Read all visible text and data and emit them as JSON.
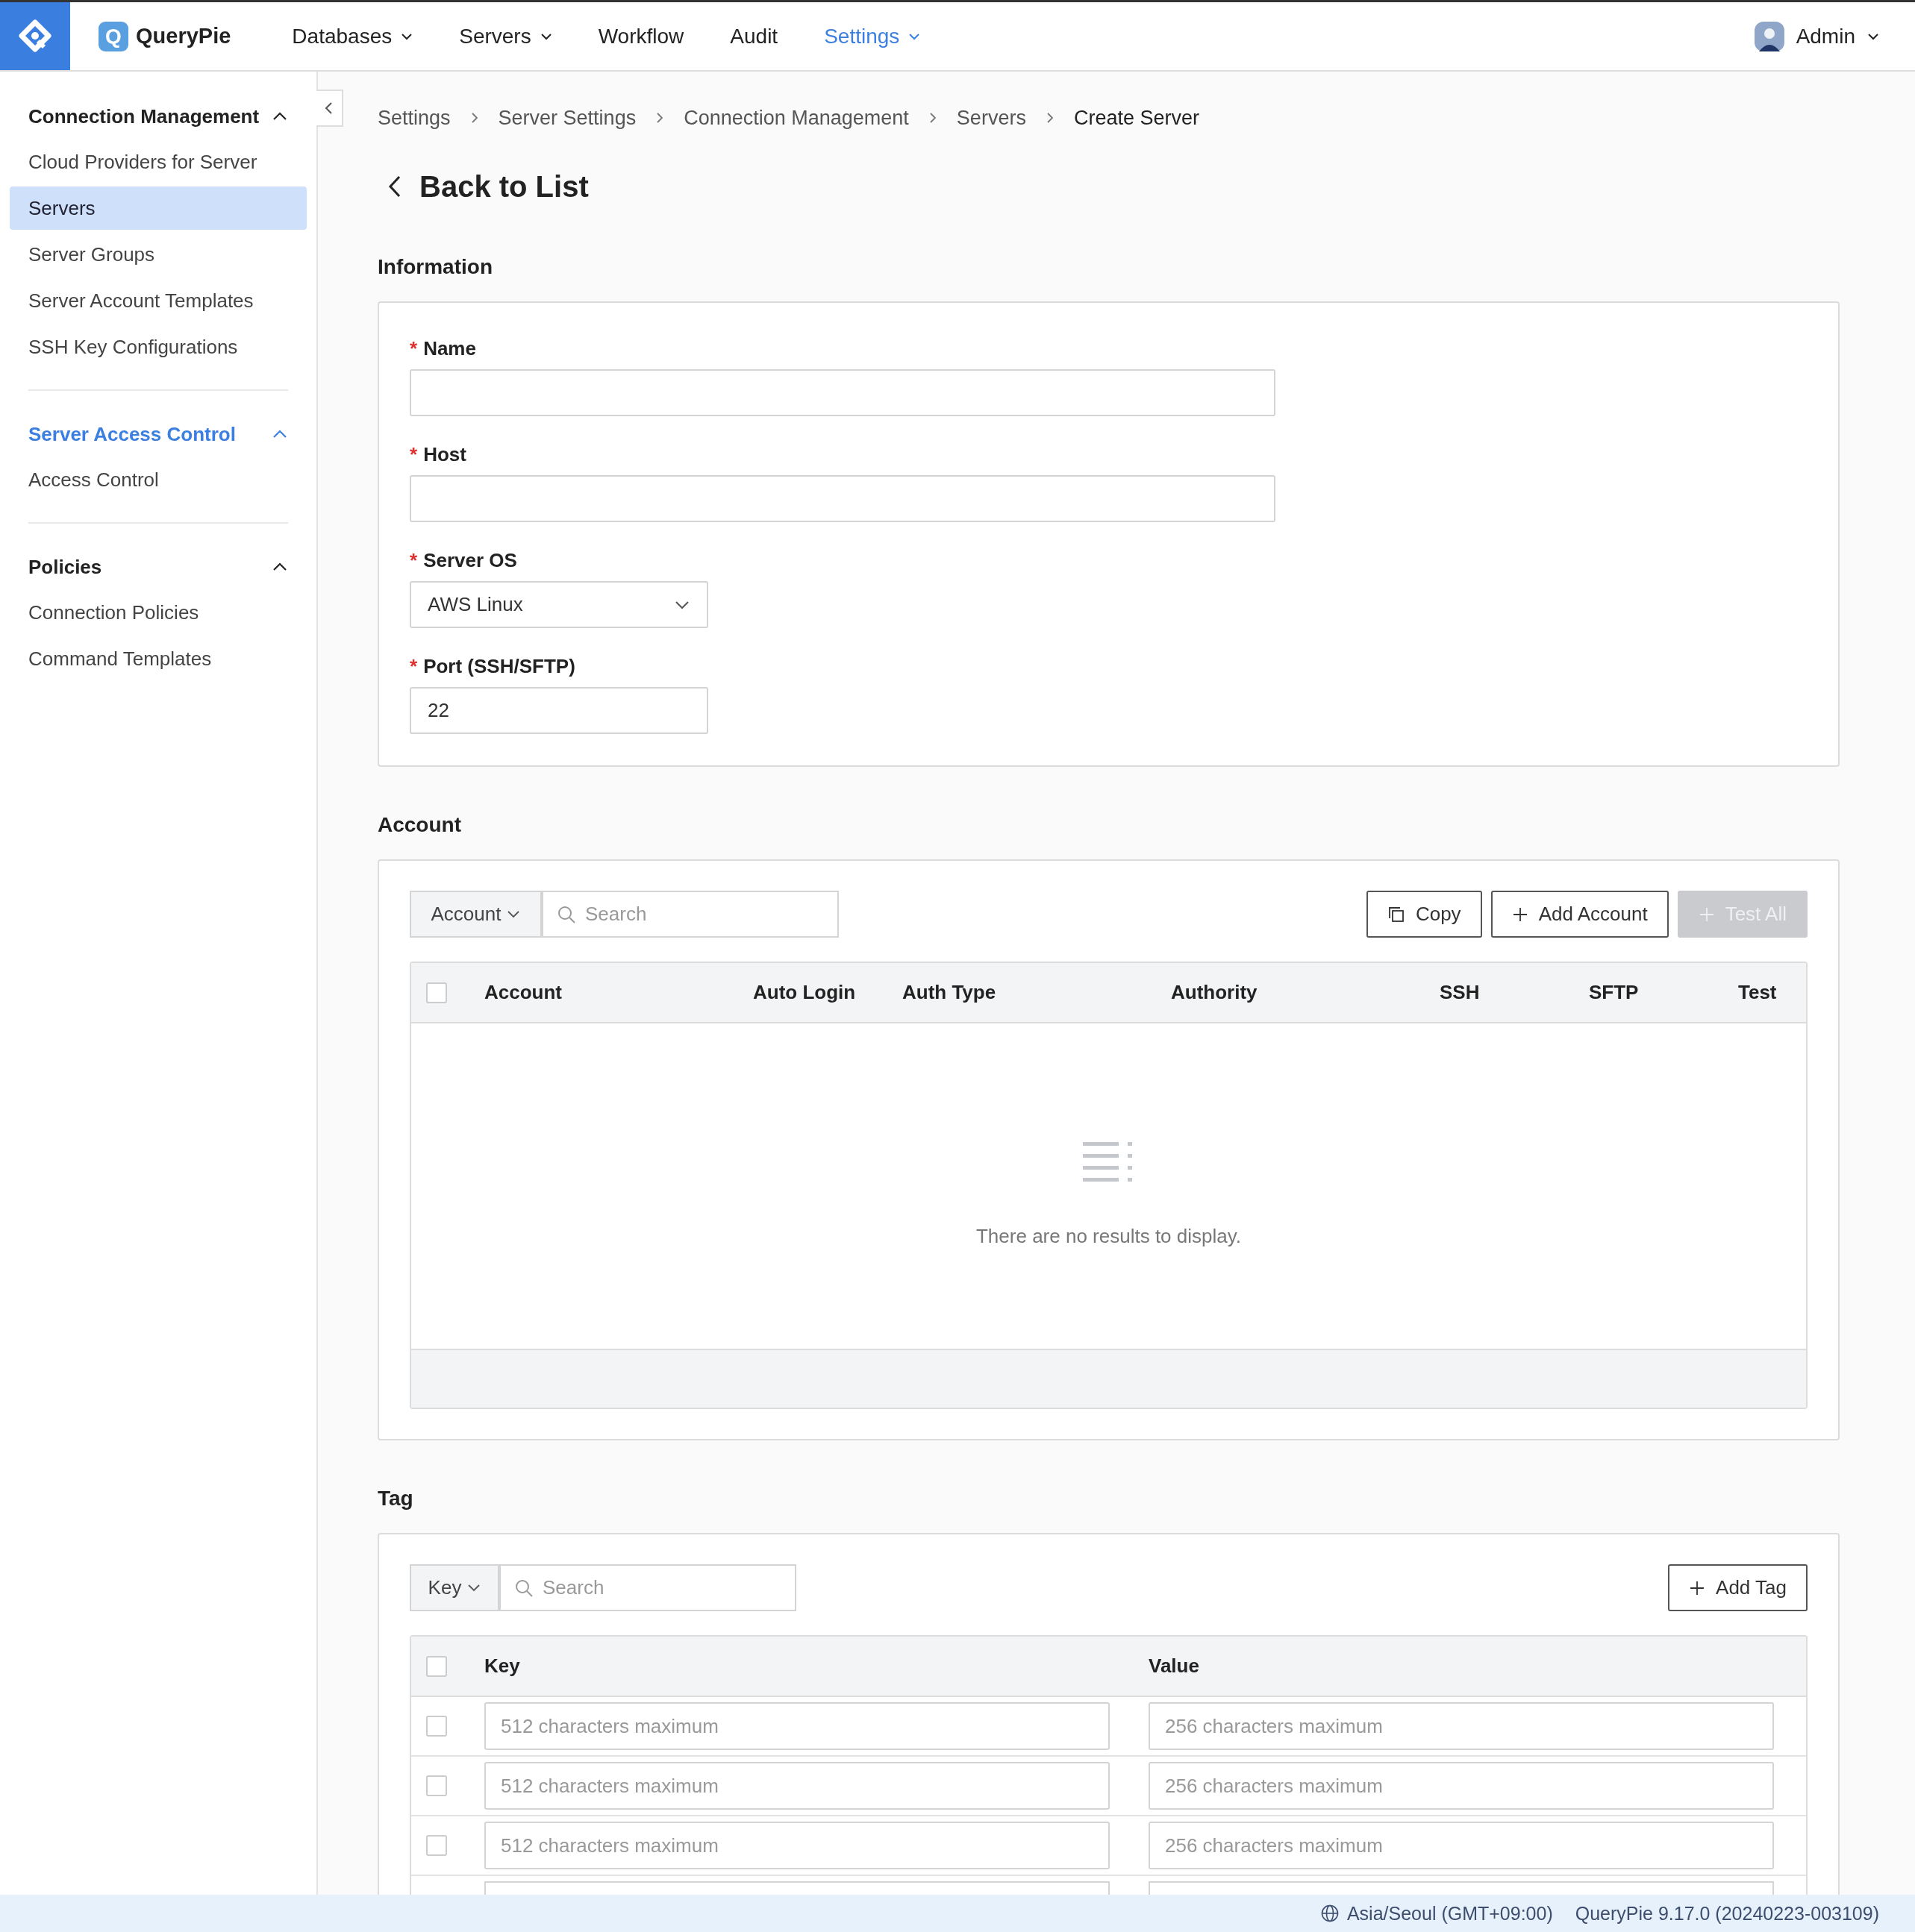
{
  "app": {
    "name": "QueryPie",
    "logo_letter": "Q"
  },
  "nav": [
    {
      "label": "Databases",
      "dropdown": true,
      "selected": false
    },
    {
      "label": "Servers",
      "dropdown": true,
      "selected": false
    },
    {
      "label": "Workflow",
      "dropdown": false,
      "selected": false
    },
    {
      "label": "Audit",
      "dropdown": false,
      "selected": false
    },
    {
      "label": "Settings",
      "dropdown": true,
      "selected": true
    }
  ],
  "user": {
    "name": "Admin"
  },
  "sidebar": {
    "sections": [
      {
        "title": "Connection Management",
        "active": false,
        "expanded": true,
        "items": [
          {
            "label": "Cloud Providers for Server",
            "selected": false
          },
          {
            "label": "Servers",
            "selected": true
          },
          {
            "label": "Server Groups",
            "selected": false
          },
          {
            "label": "Server Account Templates",
            "selected": false
          },
          {
            "label": "SSH Key Configurations",
            "selected": false
          }
        ]
      },
      {
        "title": "Server Access Control",
        "active": true,
        "expanded": true,
        "items": [
          {
            "label": "Access Control",
            "selected": false
          }
        ]
      },
      {
        "title": "Policies",
        "active": false,
        "expanded": true,
        "items": [
          {
            "label": "Connection Policies",
            "selected": false
          },
          {
            "label": "Command Templates",
            "selected": false
          }
        ]
      }
    ]
  },
  "breadcrumb": [
    "Settings",
    "Server Settings",
    "Connection Management",
    "Servers",
    "Create Server"
  ],
  "back_link": "Back to List",
  "information": {
    "title": "Information",
    "fields": [
      {
        "label": "Name",
        "required_mark": "*",
        "kind": "text"
      },
      {
        "label": "Host",
        "required_mark": "*",
        "kind": "text"
      },
      {
        "label": "Server OS",
        "required_mark": "*",
        "kind": "select",
        "value": "AWS Linux"
      },
      {
        "label": "Port (SSH/SFTP)",
        "required_mark": "*",
        "kind": "text",
        "value": "22"
      }
    ]
  },
  "account": {
    "title": "Account",
    "filter": "Account",
    "search_placeholder": "Search",
    "buttons": [
      {
        "label": "Copy",
        "kind": "copy",
        "disabled": false
      },
      {
        "label": "Add Account",
        "kind": "add",
        "disabled": false
      },
      {
        "label": "Test All",
        "kind": "add",
        "disabled": true
      }
    ],
    "select_all_checked": false,
    "columns": [
      "Account",
      "Auto Login",
      "Auth Type",
      "Authority",
      "SSH",
      "SFTP",
      "Test"
    ],
    "empty_message": "There are no results to display."
  },
  "tag": {
    "title": "Tag",
    "filter": "Key",
    "search_placeholder": "Search",
    "buttons": [
      {
        "label": "Add Tag",
        "kind": "add",
        "disabled": false
      }
    ],
    "select_all_checked": false,
    "columns": [
      "Key",
      "Value"
    ],
    "rows": [
      {
        "checked": false,
        "key_placeholder": "512 characters maximum",
        "value_placeholder": "256 characters maximum"
      },
      {
        "checked": false,
        "key_placeholder": "512 characters maximum",
        "value_placeholder": "256 characters maximum"
      },
      {
        "checked": false,
        "key_placeholder": "512 characters maximum",
        "value_placeholder": "256 characters maximum"
      }
    ]
  },
  "status_bar": {
    "timezone": "Asia/Seoul (GMT+09:00)",
    "version": "QueryPie 9.17.0 (20240223-003109)"
  }
}
